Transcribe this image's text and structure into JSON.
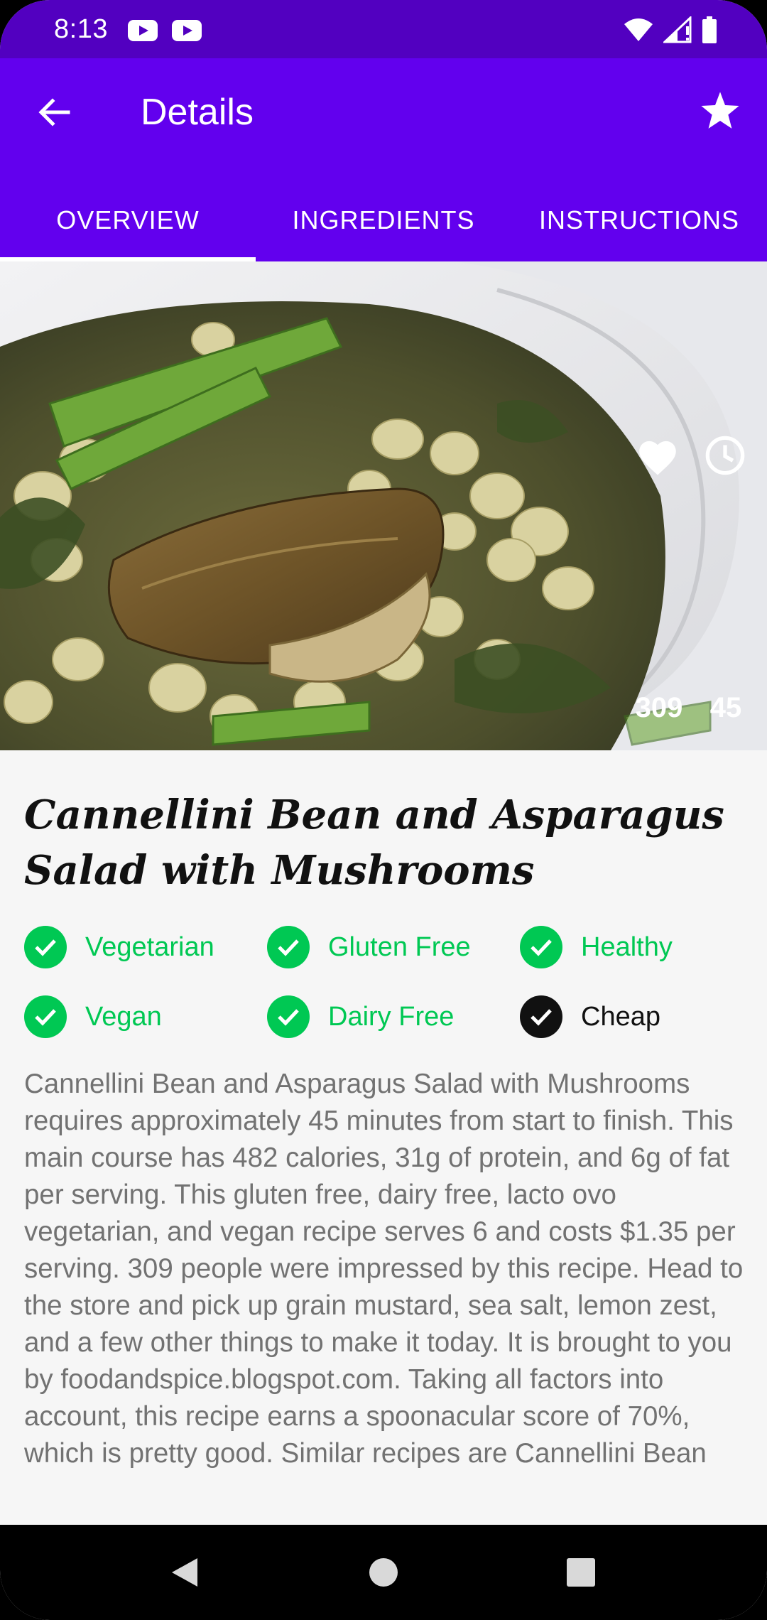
{
  "status_bar": {
    "time": "8:13"
  },
  "app_bar": {
    "title": "Details"
  },
  "tabs": [
    {
      "label": "OVERVIEW",
      "selected": true
    },
    {
      "label": "INGREDIENTS",
      "selected": false
    },
    {
      "label": "INSTRUCTIONS",
      "selected": false
    }
  ],
  "hero": {
    "likes": "309",
    "minutes": "45"
  },
  "recipe": {
    "title": "Cannellini Bean and Asparagus Salad with Mushrooms",
    "tags": [
      {
        "label": "Vegetarian",
        "active": true
      },
      {
        "label": "Gluten Free",
        "active": true
      },
      {
        "label": "Healthy",
        "active": true
      },
      {
        "label": "Vegan",
        "active": true
      },
      {
        "label": "Dairy Free",
        "active": true
      },
      {
        "label": "Cheap",
        "active": false
      }
    ],
    "summary": "Cannellini Bean and Asparagus Salad with Mushrooms requires approximately 45 minutes from start to finish. This main course has 482 calories, 31g of protein, and 6g of fat per serving. This gluten free, dairy free, lacto ovo vegetarian, and vegan recipe serves 6 and costs $1.35 per serving. 309 people were impressed by this recipe. Head to the store and pick up grain mustard, sea salt, lemon zest, and a few other things to make it today. It is brought to you by foodandspice.blogspot.com. Taking all factors into account, this recipe earns a spoonacular score of 70%, which is pretty good. Similar recipes are Cannellini Bean"
  },
  "colors": {
    "status_bar": "#5200c0",
    "app_bar": "#6200ee",
    "tag_active": "#00c853",
    "tag_inactive": "#111111",
    "summary_text": "#727272"
  },
  "icons": {
    "back": "arrow-back-icon",
    "favorite": "star-icon",
    "likes": "heart-icon",
    "time": "clock-icon",
    "check": "check-circle-icon"
  }
}
